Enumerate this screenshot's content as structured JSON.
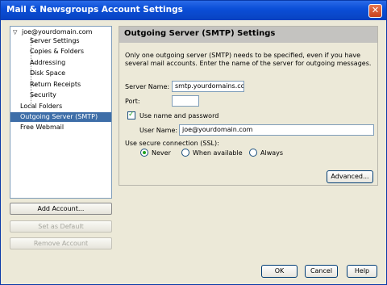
{
  "window": {
    "title": "Mail & Newsgroups Account Settings",
    "close_glyph": "✕"
  },
  "tree": {
    "expander_glyph": "▽",
    "account": "joe@yourdomain.com",
    "children": [
      "Server Settings",
      "Copies & Folders",
      "Addressing",
      "Disk Space",
      "Return Receipts",
      "Security"
    ],
    "items": [
      "Local Folders",
      "Outgoing Server (SMTP)",
      "Free Webmail"
    ],
    "selected": "Outgoing Server (SMTP)"
  },
  "left_buttons": {
    "add_account": "Add Account...",
    "set_default": "Set as Default",
    "remove_account": "Remove Account"
  },
  "panel": {
    "title": "Outgoing Server (SMTP) Settings",
    "description": "Only one outgoing server (SMTP) needs to be specified, even if you have several mail accounts. Enter the name of the server for outgoing messages.",
    "server_name_label": "Server Name:",
    "server_name_value": "smtp.yourdomains.com",
    "port_label": "Port:",
    "port_value": "",
    "use_auth_label": "Use name and password",
    "use_auth_checked": true,
    "user_name_label": "User Name:",
    "user_name_value": "joe@yourdomain.com",
    "ssl_label": "Use secure connection (SSL):",
    "ssl_options": [
      "Never",
      "When available",
      "Always"
    ],
    "ssl_selected": "Never",
    "advanced_button": "Advanced..."
  },
  "footer": {
    "ok": "OK",
    "cancel": "Cancel",
    "help": "Help"
  },
  "colors": {
    "selection": "#3e6ea8",
    "titlebar": "#0b4fd8",
    "check": "#21a121"
  }
}
